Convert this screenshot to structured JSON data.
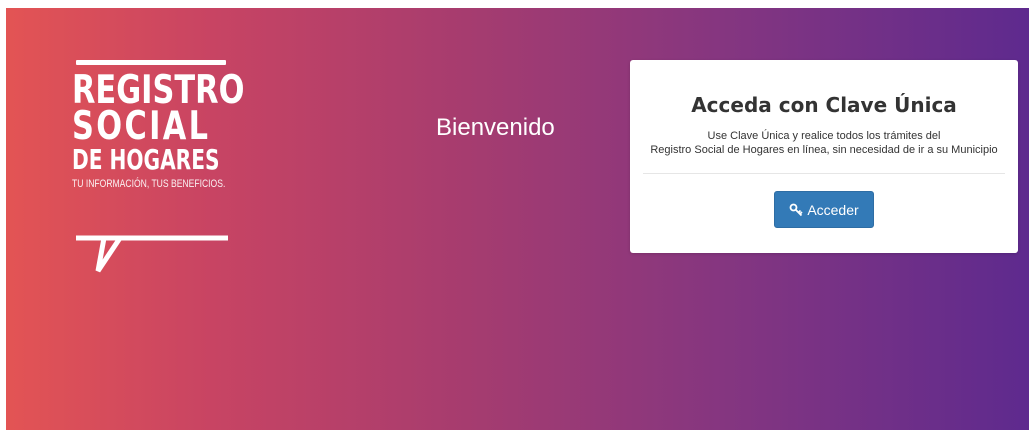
{
  "logo": {
    "line1": "REGISTRO",
    "line2": "SOCIAL",
    "line3": "DE HOGARES",
    "tagline": "TU INFORMACIÓN, TUS BENEFICIOS."
  },
  "welcome": "Bienvenido",
  "card": {
    "title": "Acceda con Clave Única",
    "desc_line1": "Use Clave Única y realice todos los trámites del",
    "desc_line2": "Registro Social de Hogares en línea, sin necesidad de ir a su Municipio",
    "button_label": "Acceder",
    "button_icon": "key-icon"
  },
  "colors": {
    "gradient_start": "#e35454",
    "gradient_end": "#5e2a8e",
    "button": "#337ab7"
  }
}
